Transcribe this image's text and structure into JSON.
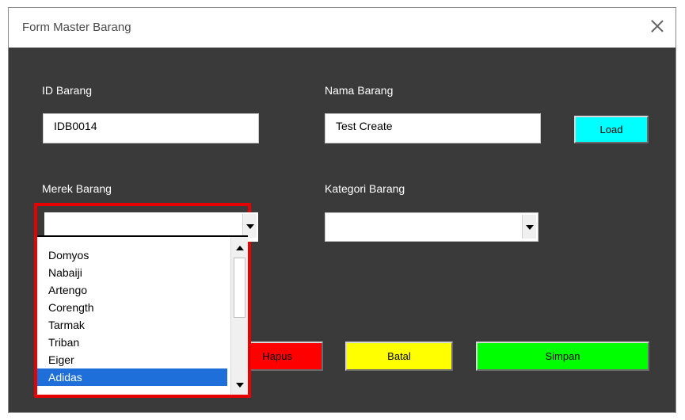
{
  "window": {
    "title": "Form Master Barang"
  },
  "form": {
    "id_label": "ID Barang",
    "id_value": "IDB0014",
    "nama_label": "Nama Barang",
    "nama_value": "Test Create",
    "load_label": "Load",
    "merek_label": "Merek Barang",
    "merek_value": "",
    "kategori_label": "Kategori Barang",
    "kategori_value": ""
  },
  "merek_list": {
    "items": [
      "Domyos",
      "Nabaiji",
      "Artengo",
      "Corength",
      "Tarmak",
      "Triban",
      "Eiger",
      "Adidas"
    ],
    "selected": "Adidas"
  },
  "buttons": {
    "hapus_label": "Hapus",
    "batal_label": "Batal",
    "simpan_label": "Simpan"
  },
  "colors": {
    "window_bg": "#3a3a3a",
    "load": "#00ffff",
    "hapus": "#ff0000",
    "batal": "#ffff00",
    "simpan": "#00ff00",
    "highlight": "#e80000",
    "selection": "#1e6fd9"
  }
}
